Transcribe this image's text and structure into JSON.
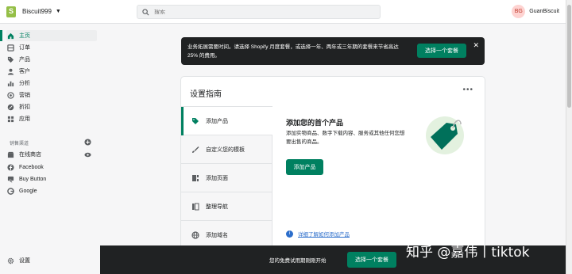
{
  "topbar": {
    "store_name": "Biscuit999",
    "search_placeholder": "搜索",
    "avatar_initials": "BG",
    "user_name": "GuanBiscuit"
  },
  "sidebar": {
    "items": [
      {
        "label": "主页",
        "icon": "home-icon"
      },
      {
        "label": "订单",
        "icon": "orders-icon"
      },
      {
        "label": "产品",
        "icon": "tag-icon"
      },
      {
        "label": "客户",
        "icon": "person-icon"
      },
      {
        "label": "分析",
        "icon": "bar-chart-icon"
      },
      {
        "label": "营销",
        "icon": "target-icon"
      },
      {
        "label": "折扣",
        "icon": "discount-icon"
      },
      {
        "label": "应用",
        "icon": "apps-icon"
      }
    ],
    "channels_heading": "销售渠道",
    "channels": [
      {
        "label": "在线商店",
        "icon": "store-icon"
      },
      {
        "label": "Facebook",
        "icon": "facebook-icon"
      },
      {
        "label": "Buy Button",
        "icon": "buy-button-icon"
      },
      {
        "label": "Google",
        "icon": "google-icon"
      }
    ],
    "settings_label": "设置"
  },
  "banner": {
    "text": "业务拓展需要时间。请选择 Shopify 月度套餐，或选择一年、两年或三年期的套餐来节省高达 25% 的费用。",
    "button_label": "选择一个套餐"
  },
  "guide": {
    "title": "设置指南",
    "more": "•••",
    "items": [
      {
        "label": "添加产品",
        "icon": "tag-icon"
      },
      {
        "label": "自定义您的模板",
        "icon": "brush-icon"
      },
      {
        "label": "添加页面",
        "icon": "page-icon"
      },
      {
        "label": "整理导航",
        "icon": "navigation-icon"
      },
      {
        "label": "添加域名",
        "icon": "globe-icon"
      }
    ],
    "detail": {
      "title": "添加您的首个产品",
      "description": "添加实物商品、数字下载内容、服务或其他任何您想要出售的商品。",
      "button_label": "添加产品",
      "help_link": "详细了解如何添加产品"
    }
  },
  "bottombar": {
    "text": "您的免费试用期刚刚开始",
    "button_label": "选择一个套餐"
  },
  "watermark": "知乎 @嘉伟丨tiktok",
  "colors": {
    "accent": "#008060",
    "dark": "#202223",
    "link": "#2c6ecb"
  }
}
